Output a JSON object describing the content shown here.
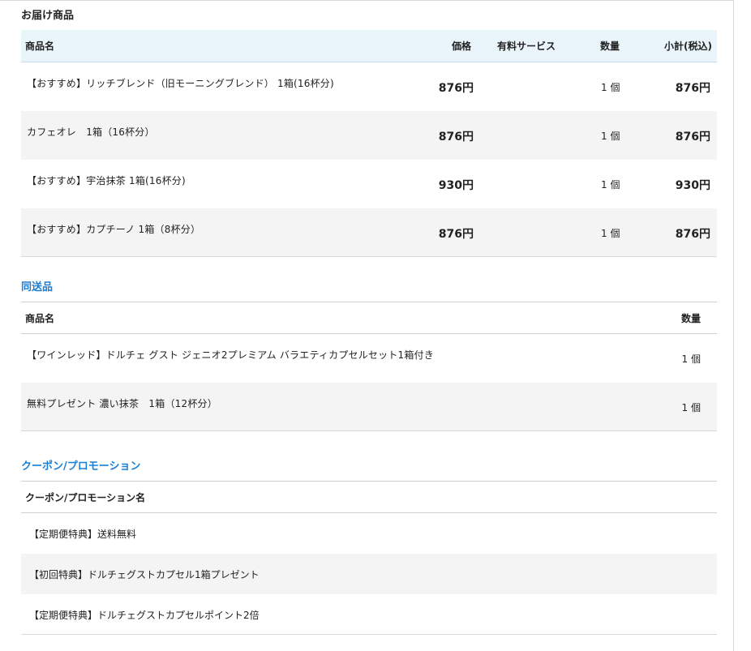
{
  "delivery": {
    "title": "お届け商品",
    "headers": {
      "name": "商品名",
      "price": "価格",
      "service": "有料サービス",
      "qty": "数量",
      "subtotal": "小計(税込)"
    },
    "rows": [
      {
        "name": "【おすすめ】リッチブレンド（旧モーニングブレンド） 1箱(16杯分)",
        "price": "876円",
        "qty": "1 個",
        "subtotal": "876円"
      },
      {
        "name": "カフェオレ　1箱（16杯分）",
        "price": "876円",
        "qty": "1 個",
        "subtotal": "876円"
      },
      {
        "name": "【おすすめ】宇治抹茶 1箱(16杯分)",
        "price": "930円",
        "qty": "1 個",
        "subtotal": "930円"
      },
      {
        "name": "【おすすめ】カプチーノ 1箱（8杯分）",
        "price": "876円",
        "qty": "1 個",
        "subtotal": "876円"
      }
    ]
  },
  "bundled": {
    "title": "同送品",
    "headers": {
      "name": "商品名",
      "qty": "数量"
    },
    "rows": [
      {
        "name": "【ワインレッド】ドルチェ グスト ジェニオ2プレミアム バラエティカプセルセット1箱付き",
        "qty": "1 個"
      },
      {
        "name": "無料プレゼント 濃い抹茶　1箱（12杯分）",
        "qty": "1 個"
      }
    ]
  },
  "coupon": {
    "title": "クーポン/プロモーション",
    "headers": {
      "name": "クーポン/プロモーション名"
    },
    "rows": [
      {
        "name": "【定期便特典】送料無料"
      },
      {
        "name": "【初回特典】ドルチェグストカプセル1箱プレゼント"
      },
      {
        "name": "【定期便特典】ドルチェグストカプセルポイント2倍"
      }
    ]
  }
}
